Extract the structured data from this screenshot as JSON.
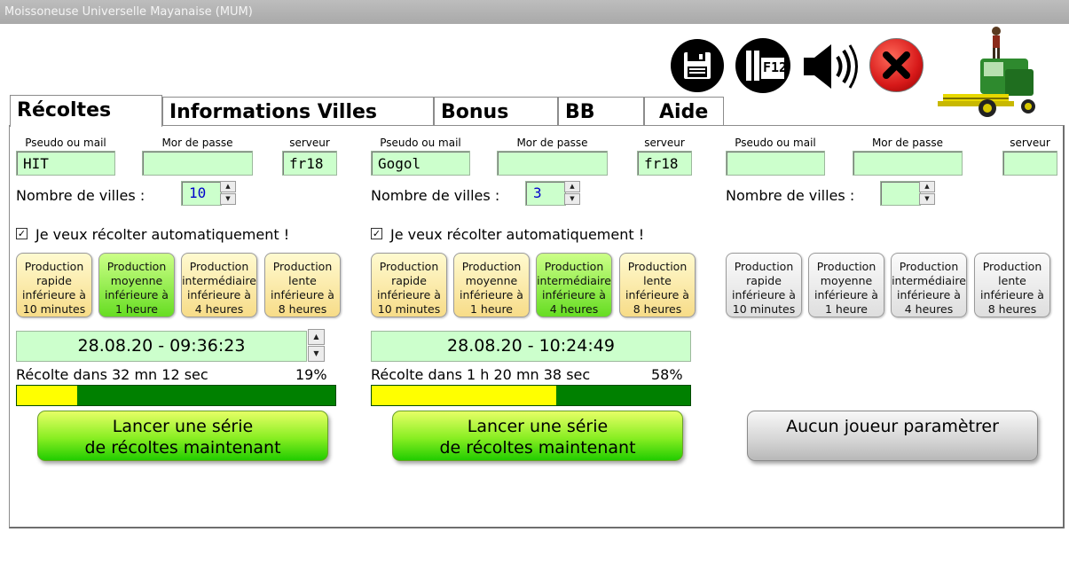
{
  "window": {
    "title": "Moissoneuse Universelle Mayanaise (MUM)"
  },
  "toolbar": {
    "f12_label": "F12"
  },
  "tabs": [
    {
      "label": "Récoltes",
      "active": true
    },
    {
      "label": "Informations Villes",
      "active": false
    },
    {
      "label": "Bonus",
      "active": false
    },
    {
      "label": "BB",
      "active": false
    },
    {
      "label": "Aide",
      "active": false
    }
  ],
  "labels": {
    "pseudo": "Pseudo ou mail",
    "password": "Mor de passe",
    "server": "serveur",
    "nb_villes": "Nombre de villes :",
    "auto": "Je veux récolter automatiquement !"
  },
  "production_buttons": [
    {
      "l1": "Production",
      "l2": "rapide",
      "l3": "inférieure à",
      "l4": "10 minutes"
    },
    {
      "l1": "Production",
      "l2": "moyenne",
      "l3": "inférieure à",
      "l4": "1 heure"
    },
    {
      "l1": "Production",
      "l2": "intermédiaire",
      "l3": "inférieure à",
      "l4": "4 heures"
    },
    {
      "l1": "Production",
      "l2": "lente",
      "l3": "inférieure à",
      "l4": "8 heures"
    }
  ],
  "players": [
    {
      "pseudo": "HIT",
      "password": "",
      "server": "fr18",
      "villes": "10",
      "auto_checked": true,
      "selected_production": 1,
      "datetime": "28.08.20 - 09:36:23",
      "harvest_text": "Récolte dans 32 mn 12 sec",
      "percent_label": "19%",
      "progress": 0.19,
      "launch_label": "Lancer une série\nde récoltes maintenant"
    },
    {
      "pseudo": "Gogol",
      "password": "",
      "server": "fr18",
      "villes": "3",
      "auto_checked": true,
      "selected_production": 2,
      "datetime": "28.08.20 - 10:24:49",
      "harvest_text": "Récolte dans 1 h 20 mn 38 sec",
      "percent_label": "58%",
      "progress": 0.58,
      "launch_label": "Lancer une série\nde récoltes maintenant"
    },
    {
      "pseudo": "",
      "password": "",
      "server": "",
      "villes": "",
      "no_player_label": "Aucun joueur paramètrer"
    }
  ],
  "icons": {
    "save": "floppy-disk-icon",
    "pause": "pause-f12-icon",
    "sound": "speaker-icon",
    "close": "close-icon",
    "logo": "combine-harvester-icon"
  },
  "colors": {
    "field_bg": "#ccffcc",
    "progress_fill": "#ffff00",
    "progress_bg": "#008000",
    "close_red": "#e02020"
  }
}
